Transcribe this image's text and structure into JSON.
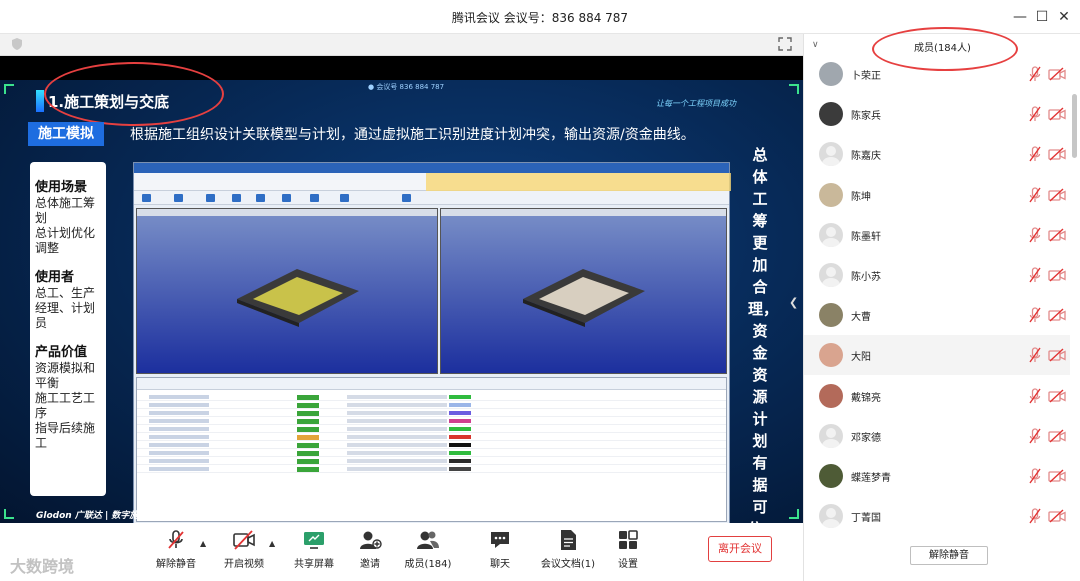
{
  "window": {
    "title": "腾讯会议 会议号：836 884 787"
  },
  "slide": {
    "meeting_id": "● 会议号 836 884 787",
    "title": "1.施工策划与交底",
    "slogan": "让每一个工程项目成功",
    "section_label": "施工模拟",
    "section_desc": "根据施工组织设计关联模型与计划，通过虚拟施工识别进度计划冲突，输出资源/资金曲线。",
    "card": [
      {
        "head": "使用场景",
        "lines": [
          "总体施工筹",
          "划",
          "总计划优化",
          "调整"
        ]
      },
      {
        "head": "使用者",
        "lines": [
          "总工、生产",
          "经理、计划",
          "员"
        ]
      },
      {
        "head": "产品价值",
        "lines": [
          "资源模拟和",
          "平衡",
          "施工工艺工",
          "序",
          "指导后续施",
          "工"
        ]
      }
    ],
    "vertical_text": "总体工筹更加合理，资金资源计划有据可依。",
    "brand": "Glodon 广联达 | 数字施工"
  },
  "toolbar": {
    "unmute": "解除静音",
    "video": "开启视频",
    "share": "共享屏幕",
    "invite": "邀请",
    "members": "成员(184)",
    "chat": "聊天",
    "docs": "会议文档(1)",
    "settings": "设置",
    "leave": "离开会议",
    "watermark": "大数跨境"
  },
  "panel": {
    "title": "成员(184人)",
    "members": [
      {
        "name": "卜荣正"
      },
      {
        "name": "陈家兵"
      },
      {
        "name": "陈嘉庆"
      },
      {
        "name": "陈坤"
      },
      {
        "name": "陈墨轩"
      },
      {
        "name": "陈小苏"
      },
      {
        "name": "大曹"
      },
      {
        "name": "大阳"
      },
      {
        "name": "戴锦亮"
      },
      {
        "name": "邓家德"
      },
      {
        "name": "蝶莲梦青"
      },
      {
        "name": "丁菁国"
      }
    ],
    "unmute_all": "解除静音"
  }
}
